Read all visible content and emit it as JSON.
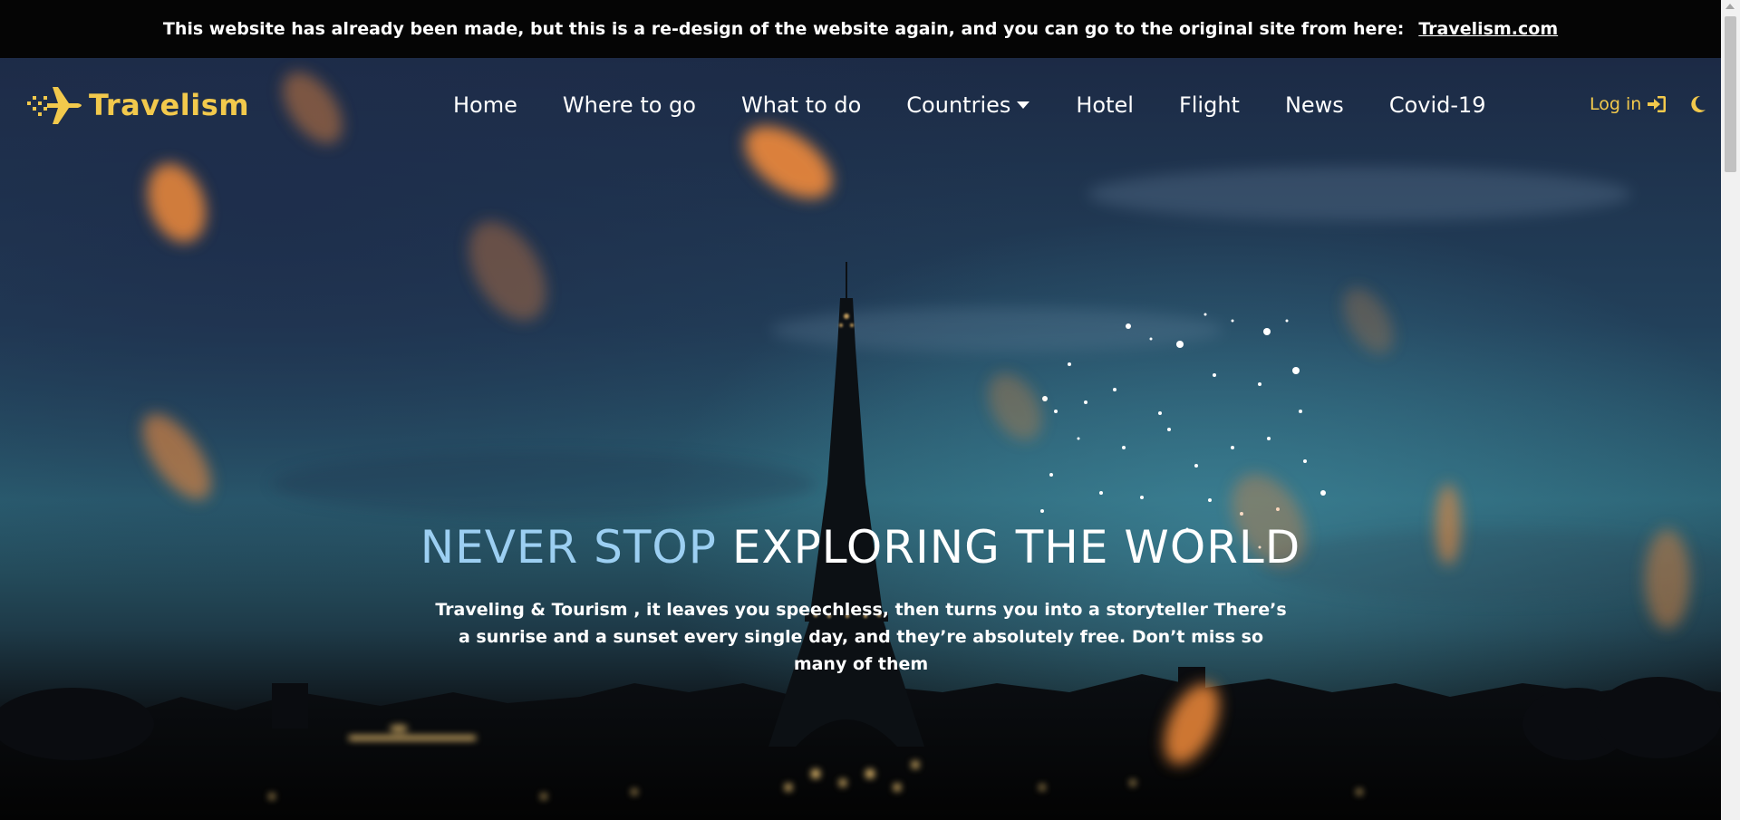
{
  "banner": {
    "message": "This website has already been made, but this is a re-design of the website again, and you can go to the original site from here:",
    "link_text": "Travelism.com"
  },
  "brand": {
    "name": "Travelism",
    "icon": "plane-icon",
    "color": "#f2c94c"
  },
  "nav": {
    "items": [
      {
        "label": "Home"
      },
      {
        "label": "Where to go"
      },
      {
        "label": "What to do"
      },
      {
        "label": "Countries",
        "icon": "caret-down-icon"
      },
      {
        "label": "Hotel"
      },
      {
        "label": "Flight"
      },
      {
        "label": "News"
      },
      {
        "label": "Covid-19"
      }
    ],
    "login_label": "Log in",
    "login_icon": "sign-in-icon",
    "theme_icon": "moon-icon"
  },
  "hero": {
    "headline_accent": "NEVER STOP",
    "headline_rest": " EXPLORING THE WORLD",
    "subtext": "Traveling & Tourism , it leaves you speechless, then turns you into a storyteller There’s a sunrise and a sunset every single day, and they’re absolutely free. Don’t miss so many of them",
    "accent_color": "#9ccff2"
  }
}
